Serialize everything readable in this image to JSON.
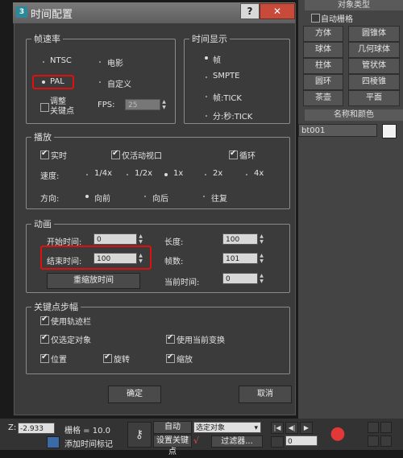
{
  "right_panel": {
    "title": "对象类型",
    "autogrid_label": "自动栅格",
    "buttons": [
      [
        "方体",
        "圆锥体"
      ],
      [
        "球体",
        "几何球体"
      ],
      [
        "柱体",
        "管状体"
      ],
      [
        "圆环",
        "四棱锥"
      ],
      [
        "茶壶",
        "平面"
      ]
    ],
    "name_color_title": "名称和颜色",
    "object_name": "bt001"
  },
  "dialog": {
    "title": "时间配置",
    "help_label": "?",
    "close_label": "✕",
    "frame_rate": {
      "legend": "帧速率",
      "options": [
        "NTSC",
        "电影",
        "PAL",
        "自定义"
      ],
      "selected": "PAL",
      "adjust_keys_label": "调整\n关键点",
      "fps_label": "FPS:",
      "fps_value": "25"
    },
    "time_display": {
      "legend": "时间显示",
      "options": [
        "帧",
        "SMPTE",
        "帧:TICK",
        "分:秒:TICK"
      ],
      "selected": "帧"
    },
    "playback": {
      "legend": "播放",
      "realtime_label": "实时",
      "active_viewport_label": "仅活动视口",
      "loop_label": "循环",
      "speed_label": "速度:",
      "speeds": [
        "1/4x",
        "1/2x",
        "1x",
        "2x",
        "4x"
      ],
      "speed_selected": "1x",
      "direction_label": "方向:",
      "directions": [
        "向前",
        "向后",
        "往复"
      ],
      "direction_selected": "向前"
    },
    "animation": {
      "legend": "动画",
      "start_time_label": "开始时间:",
      "start_time": "0",
      "end_time_label": "结束时间:",
      "end_time": "100",
      "length_label": "长度:",
      "length": "100",
      "frame_count_label": "帧数:",
      "frame_count": "101",
      "rescale_label": "重缩放时间",
      "current_time_label": "当前时间:",
      "current_time": "0"
    },
    "key_steps": {
      "legend": "关键点步幅",
      "use_trackbar_label": "使用轨迹栏",
      "selected_only_label": "仅选定对象",
      "use_current_transform_label": "使用当前变换",
      "position_label": "位置",
      "rotation_label": "旋转",
      "scale_label": "缩放"
    },
    "ok_label": "确定",
    "cancel_label": "取消"
  },
  "bottom_bar": {
    "z_label": "Z:",
    "z_value": "-2.933",
    "grid_label": "栅格 = 10.0",
    "auto_label": "自动",
    "selected_object_label": "选定对象",
    "set_key_label": "设置关键点",
    "filter_label": "过滤器...",
    "add_time_tag_label": "添加时间标记",
    "frame_value": "0"
  },
  "colors": {
    "highlight_box": "#e01010",
    "close_button": "#c84a3a",
    "dialog_bg": "#3b3b3b"
  }
}
